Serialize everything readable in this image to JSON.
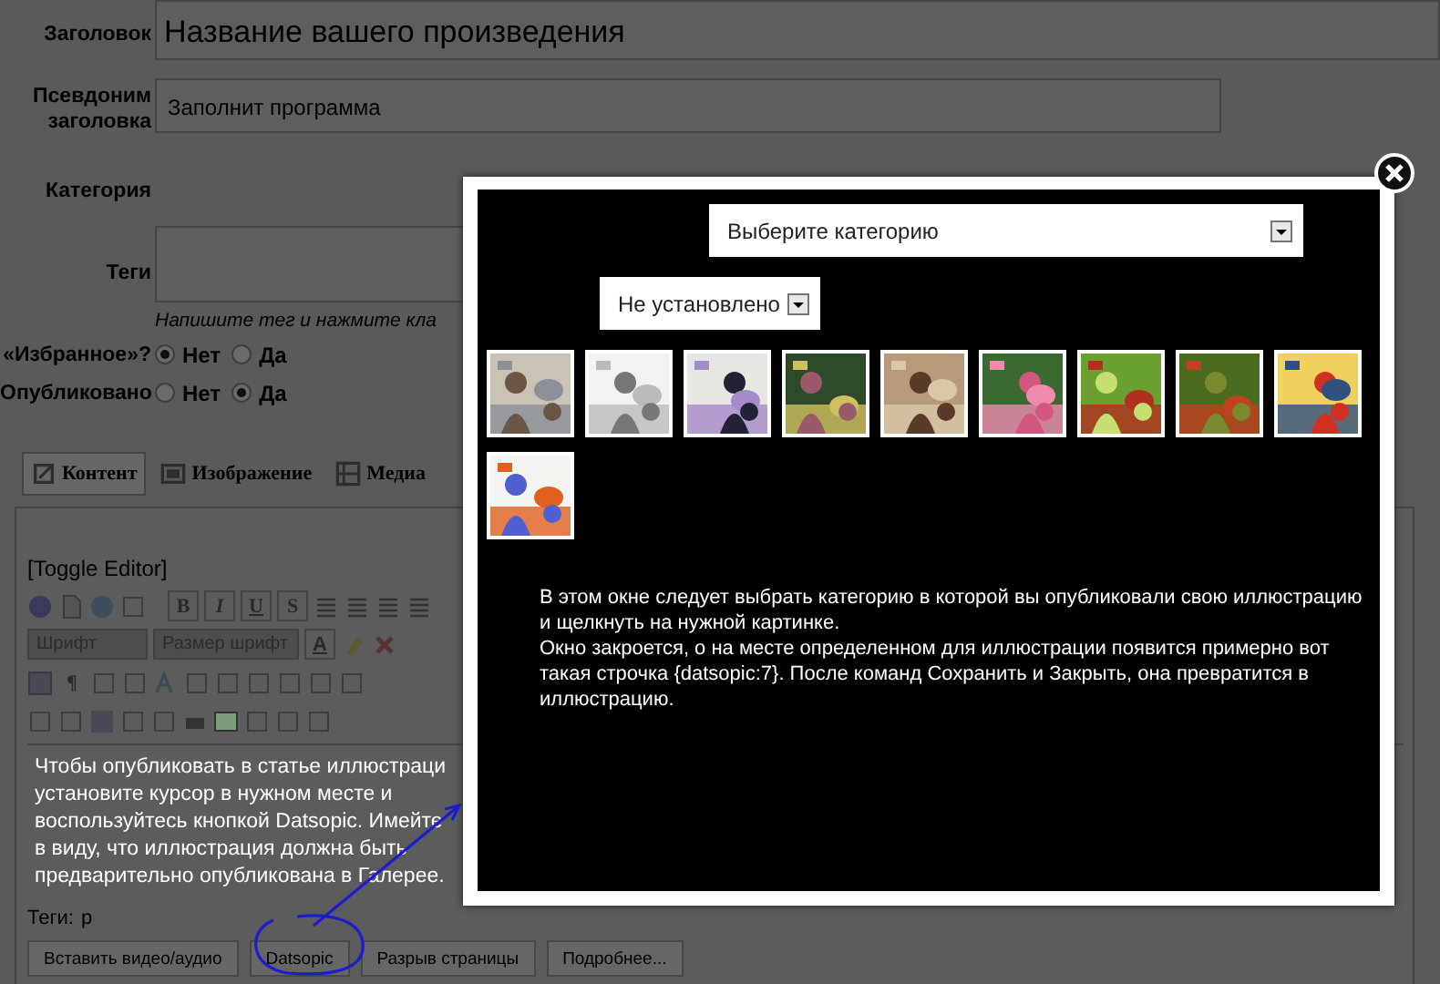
{
  "form": {
    "fields": [
      {
        "label": "Заголовок",
        "kind": "title",
        "value": "Название вашего произведения"
      },
      {
        "label": "Псевдоним заголовка",
        "kind": "text",
        "value": "Заполнит программа"
      },
      {
        "label": "Категория",
        "kind": "label"
      },
      {
        "label": "Теги",
        "kind": "tags",
        "help_text": "Напишите тег и нажмите кла"
      }
    ],
    "radios": [
      {
        "label": "«Избранное»?",
        "options": [
          {
            "label": "Нет",
            "selected": true
          },
          {
            "label": "Да",
            "selected": false
          }
        ]
      },
      {
        "label": "Опубликовано",
        "options": [
          {
            "label": "Нет",
            "selected": false
          },
          {
            "label": "Да",
            "selected": true
          }
        ]
      }
    ]
  },
  "tabs": [
    {
      "label": "Контент",
      "selected": true
    },
    {
      "label": "Изображение",
      "selected": false
    },
    {
      "label": "Медиа",
      "selected": false
    }
  ],
  "editor": {
    "toggle": "[Toggle Editor]",
    "format_buttons": [
      "B",
      "I",
      "U",
      "S"
    ],
    "font_select": "Шрифт",
    "size_select": "Размер шрифт",
    "color_button": "A",
    "pilcrow": "¶",
    "content_lines": [
      "Чтобы опубликовать в статье иллюстраци",
      "установите курсор в нужном месте и",
      "воспользуйтесь кнопкой Datsopic. Имейте",
      "в виду, что иллюстрация должна быть",
      "предварительно опубликована в Галерее."
    ],
    "tags_label": "Теги:",
    "tags_value": "p",
    "buttons": [
      "Вставить видео/аудио",
      "Datsopic",
      "Разрыв страницы",
      "Подробнее..."
    ]
  },
  "modal": {
    "category_select": "Выберите категорию",
    "filter_select": "Не установлено",
    "thumbnails": [
      {
        "kind": "picture"
      },
      {
        "kind": "picture"
      },
      {
        "kind": "picture"
      },
      {
        "kind": "picture"
      },
      {
        "kind": "picture"
      },
      {
        "kind": "picture"
      },
      {
        "kind": "picture"
      },
      {
        "kind": "picture"
      },
      {
        "kind": "picture"
      },
      {
        "kind": "picture"
      }
    ],
    "paragraphs": [
      "В этом окне следует выбрать категорию в которой вы опубликовали свою иллюстрацию и щелкнуть на нужной картинке.",
      "Окно закроется, о на месте определенном для иллюстрации появится примерно вот такая строчка {datsopic:7}. После команд Сохранить и Закрыть, она превратится в иллюстрацию."
    ]
  }
}
